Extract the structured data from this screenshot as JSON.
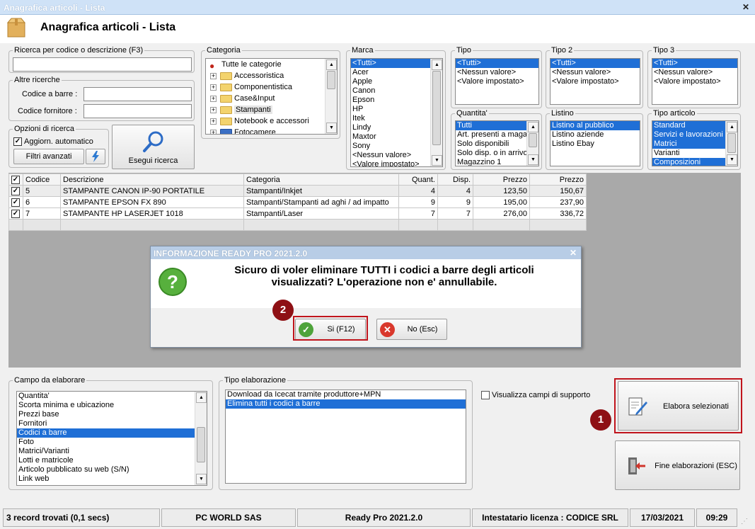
{
  "window": {
    "title": "Anagrafica articoli  - Lista",
    "header": "Anagrafica articoli  - Lista"
  },
  "search": {
    "code_label": "Ricerca per codice o descrizione (F3)",
    "code_value": "",
    "other_label": "Altre ricerche",
    "barcode_label": "Codice a barre :",
    "supplier_label": "Codice fornitore :",
    "options_label": "Opzioni di ricerca",
    "auto_update": "Aggiorn. automatico",
    "advanced_filters": "Filtri avanzati",
    "run_search": "Esegui ricerca"
  },
  "filters": {
    "categoria": {
      "label": "Categoria",
      "items": [
        "Tutte le categorie",
        "Accessoristica",
        "Componentistica",
        "Case&Input",
        "Stampanti",
        "Notebook e accessori",
        "Fotocamere"
      ]
    },
    "marca": {
      "label": "Marca",
      "items": [
        "<Tutti>",
        "Acer",
        "Apple",
        "Canon",
        "Epson",
        "HP",
        "Itek",
        "Lindy",
        "Maxtor",
        "Sony",
        "<Nessun valore>",
        "<Valore impostato>"
      ]
    },
    "tipo": {
      "label": "Tipo",
      "items": [
        "<Tutti>",
        "<Nessun valore>",
        "<Valore impostato>"
      ]
    },
    "tipo2": {
      "label": "Tipo 2",
      "items": [
        "<Tutti>",
        "<Nessun valore>",
        "<Valore impostato>"
      ]
    },
    "tipo3": {
      "label": "Tipo 3",
      "items": [
        "<Tutti>",
        "<Nessun valore>",
        "<Valore impostato>"
      ]
    },
    "quantita": {
      "label": "Quantita'",
      "items": [
        "Tutti",
        "Art. presenti a magazzino",
        "Solo disponibili",
        "Solo disp. o in arrivo",
        "Magazzino 1"
      ]
    },
    "listino": {
      "label": "Listino",
      "items": [
        "Listino al pubblico",
        "Listino aziende",
        "Listino Ebay"
      ]
    },
    "tipo_articolo": {
      "label": "Tipo articolo",
      "items": [
        "Standard",
        "Servizi e lavorazioni",
        "Matrici",
        "Varianti",
        "Composizioni"
      ]
    }
  },
  "grid": {
    "columns": [
      "Codice",
      "Descrizione",
      "Categoria",
      "Quant.",
      "Disp.",
      "Prezzo",
      "Prezzo"
    ],
    "rows": [
      {
        "codice": "5",
        "descrizione": "STAMPANTE CANON IP-90 PORTATILE",
        "categoria": "Stampanti/Inkjet",
        "quant": "4",
        "disp": "4",
        "prezzo1": "123,50",
        "prezzo2": "150,67"
      },
      {
        "codice": "6",
        "descrizione": "STAMPANTE EPSON FX 890",
        "categoria": "Stampanti/Stampanti ad aghi / ad impatto",
        "quant": "9",
        "disp": "9",
        "prezzo1": "195,00",
        "prezzo2": "237,90"
      },
      {
        "codice": "7",
        "descrizione": "STAMPANTE HP LASERJET 1018",
        "categoria": "Stampanti/Laser",
        "quant": "7",
        "disp": "7",
        "prezzo1": "276,00",
        "prezzo2": "336,72"
      }
    ]
  },
  "dialog": {
    "title": "INFORMAZIONE READY PRO 2021.2.0",
    "message_line1": "Sicuro di voler eliminare TUTTI i codici a barre degli articoli",
    "message_line2": "visualizzati? L'operazione non e' annullabile.",
    "yes": "Si (F12)",
    "no": "No (Esc)"
  },
  "process": {
    "campo_label": "Campo da elaborare",
    "campo_items": [
      "Quantita'",
      "Scorta minima e ubicazione",
      "Prezzi base",
      "Fornitori",
      "Codici a barre",
      "Foto",
      "Matrici/Varianti",
      "Lotti e matricole",
      "Articolo pubblicato su web (S/N)",
      "Link web"
    ],
    "tipo_label": "Tipo elaborazione",
    "tipo_items": [
      "Download da Icecat tramite produttore+MPN",
      "Elimina tutti i codici a barre"
    ],
    "show_support": "Visualizza campi di supporto",
    "process_selected": "Elabora selezionati",
    "end_processing": "Fine elaborazioni (ESC)"
  },
  "badges": {
    "b1": "1",
    "b2": "2"
  },
  "status": {
    "records": "3 record trovati (0,1 secs)",
    "company": "PC WORLD SAS",
    "version": "Ready Pro 2021.2.0",
    "license": "Intestatario licenza : CODICE SRL",
    "date": "17/03/2021",
    "time": "09:29"
  }
}
